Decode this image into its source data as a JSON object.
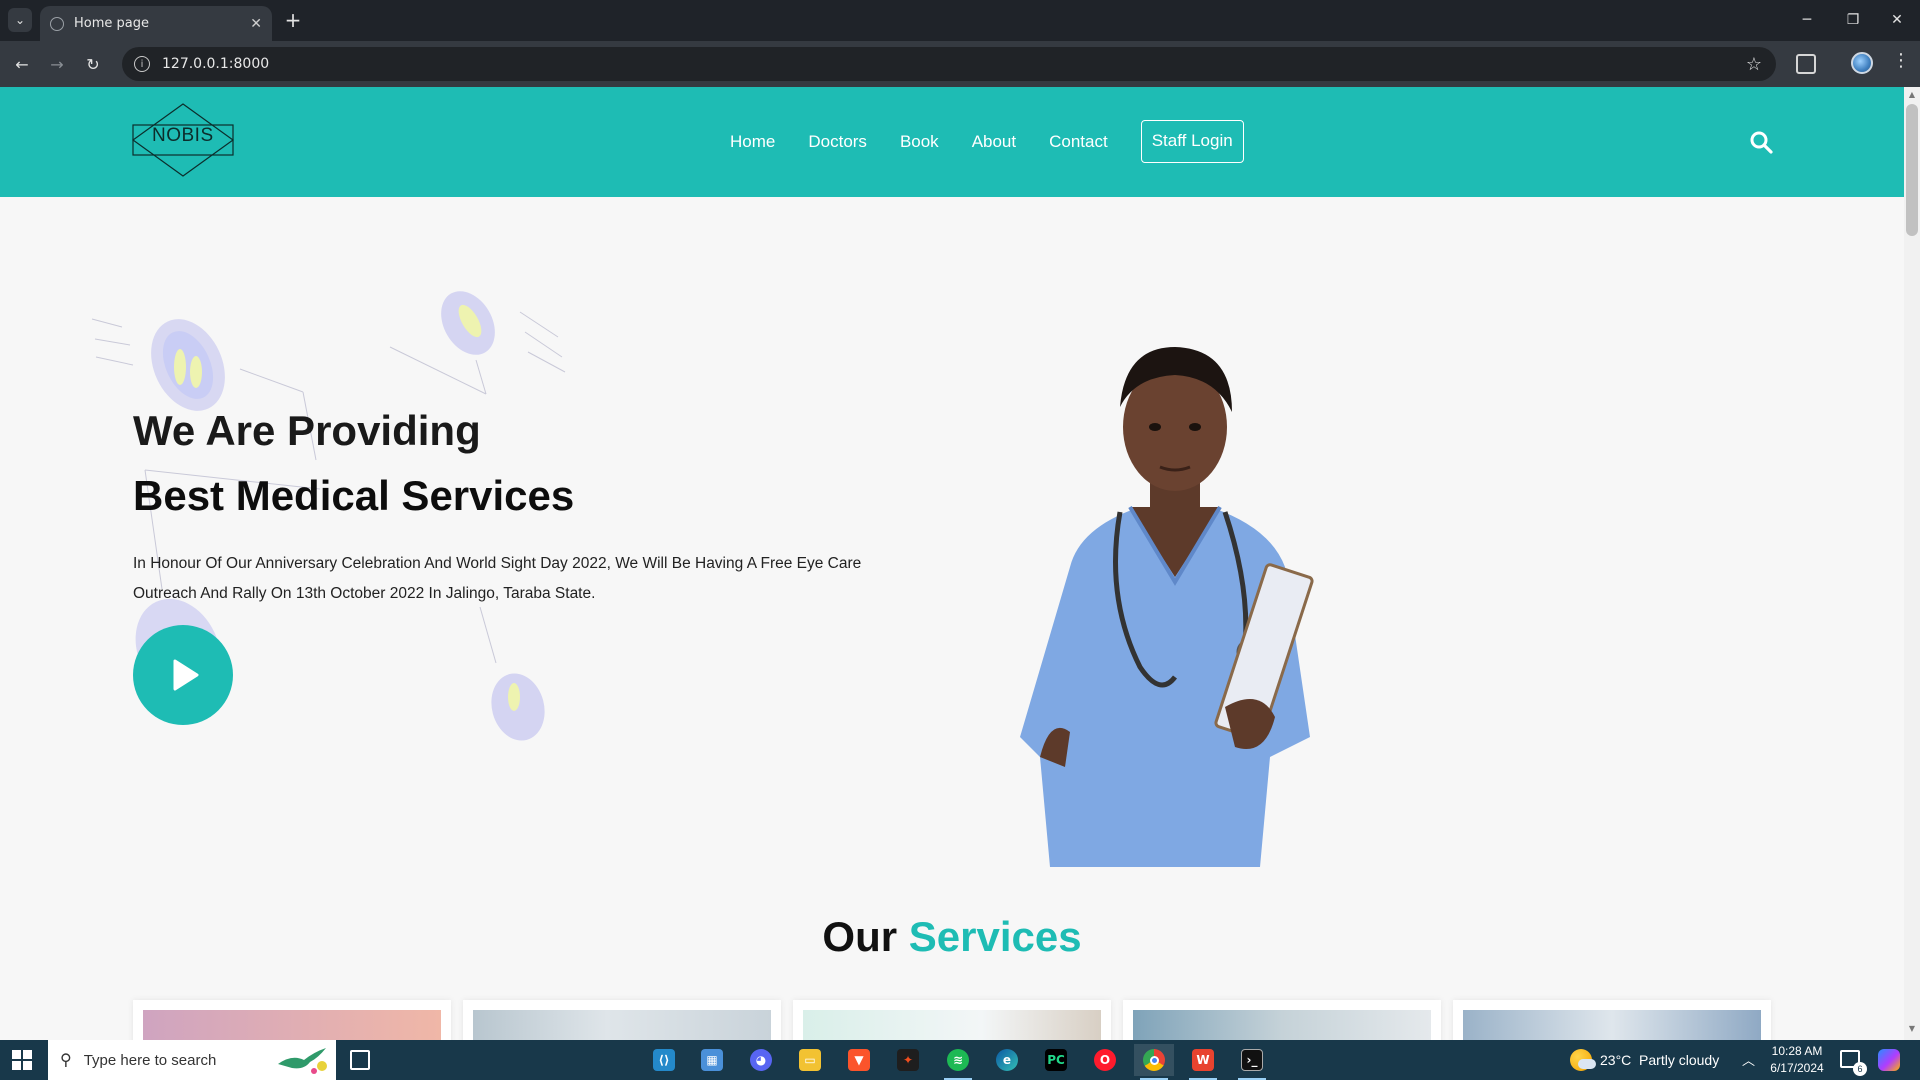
{
  "browser": {
    "tab_title": "Home page",
    "url": "127.0.0.1:8000"
  },
  "site": {
    "logo_text": "NOBIS",
    "nav": [
      "Home",
      "Doctors",
      "Book",
      "About",
      "Contact"
    ],
    "staff_login": "Staff Login",
    "brand_color": "#1ebcb4"
  },
  "hero": {
    "line1": "We Are Providing",
    "line2": "Best Medical Services",
    "text": "In Honour Of Our Anniversary Celebration And World Sight Day 2022, We Will Be Having A Free Eye Care Outreach And Rally On 13th October 2022 In Jalingo, Taraba State."
  },
  "services": {
    "title_prefix": "Our",
    "title_accent": "Services"
  },
  "taskbar": {
    "search_placeholder": "Type here to search",
    "weather": "23°C  Partly cloudy",
    "time": "10:28 AM",
    "date": "6/17/2024",
    "notification_count": "6",
    "apps": [
      "vscode-icon",
      "store-icon",
      "discord-icon",
      "file-explorer-icon",
      "brave-icon",
      "figma-icon",
      "spotify-icon",
      "edge-icon",
      "pycharm-icon",
      "opera-icon",
      "chrome-icon",
      "wps-icon",
      "terminal-icon"
    ]
  }
}
